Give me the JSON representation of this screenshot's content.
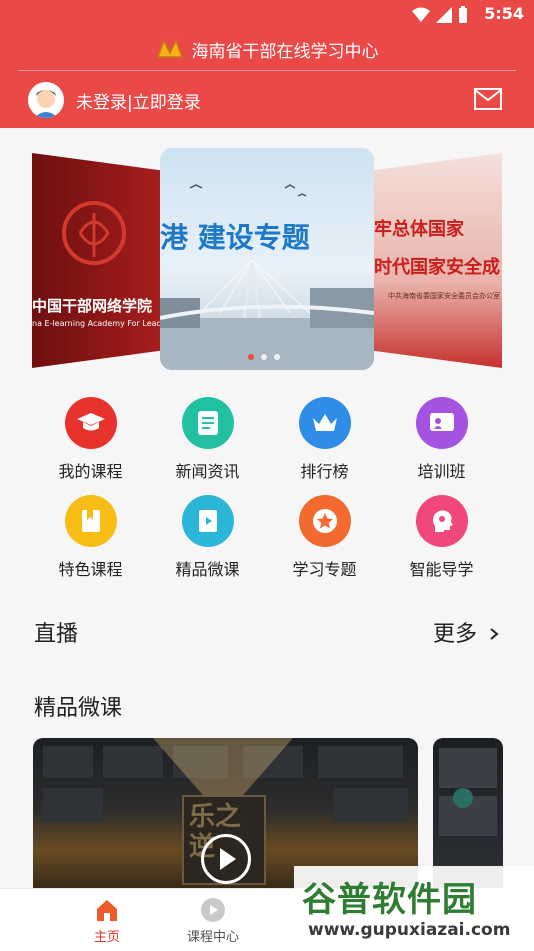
{
  "status_bar": {
    "time": "5:54"
  },
  "header": {
    "title": "海南省干部在线学习中心",
    "login_text": "未登录|立即登录"
  },
  "carousel": {
    "left_slide_text": "中国干部网络学院",
    "left_slide_sub": "na E-learning Academy For Leadership",
    "center_slide_text": "港 建设专题",
    "right_slide_text_1": "牢总体国家",
    "right_slide_text_2": "时代国家安全成",
    "right_slide_sub": "中共海南省委国家安全委员会办公室",
    "page_count": 3,
    "active_index": 0
  },
  "menu": {
    "items": [
      {
        "label": "我的课程",
        "color": "#e8332d",
        "icon": "graduation-cap-icon"
      },
      {
        "label": "新闻资讯",
        "color": "#22c0a3",
        "icon": "news-document-icon"
      },
      {
        "label": "排行榜",
        "color": "#2f8de8",
        "icon": "crown-icon"
      },
      {
        "label": "培训班",
        "color": "#a353df",
        "icon": "training-board-icon"
      },
      {
        "label": "特色课程",
        "color": "#f7bd15",
        "icon": "featured-book-icon"
      },
      {
        "label": "精品微课",
        "color": "#2bb6d8",
        "icon": "micro-course-book-icon"
      },
      {
        "label": "学习专题",
        "color": "#f26a2f",
        "icon": "star-icon"
      },
      {
        "label": "智能导学",
        "color": "#f0477c",
        "icon": "smart-brain-icon"
      }
    ]
  },
  "sections": {
    "live_title": "直播",
    "live_more": "更多",
    "micro_title": "精品微课"
  },
  "course_card": {
    "cover_text": "乐之逆"
  },
  "tabbar": {
    "tabs": [
      {
        "label": "主页",
        "active": true
      },
      {
        "label": "课程中心",
        "active": false
      }
    ]
  },
  "watermark": {
    "brand": "谷普软件园",
    "url": "www.gupuxiazai.com"
  },
  "colors": {
    "brand_red": "#e94a48",
    "tab_active": "#e8332d",
    "tab_inactive": "#555555"
  }
}
